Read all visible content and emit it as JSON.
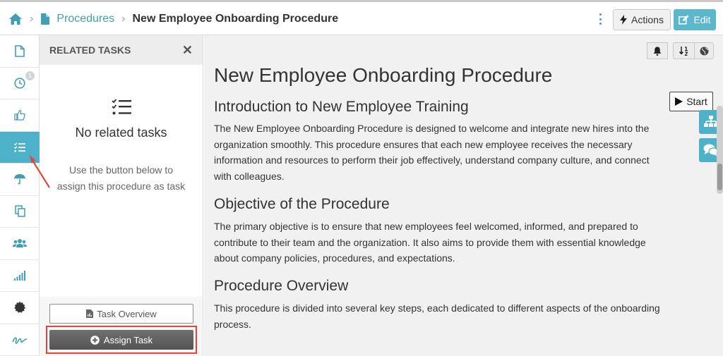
{
  "breadcrumb": {
    "home_icon": "home-icon",
    "parent_label": "Procedures",
    "parent_icon": "document-icon",
    "current_label": "New Employee Onboarding Procedure"
  },
  "toolbar": {
    "actions_label": "Actions",
    "edit_label": "Edit",
    "accent_color": "#5bb8cc"
  },
  "rail": {
    "items": [
      {
        "icon": "document-icon"
      },
      {
        "icon": "clock-icon",
        "badge": "1"
      },
      {
        "icon": "thumbs-up-icon"
      },
      {
        "icon": "tasks-icon",
        "active": true
      },
      {
        "icon": "umbrella-icon"
      },
      {
        "icon": "copy-icon"
      },
      {
        "icon": "users-icon"
      },
      {
        "icon": "signal-icon"
      },
      {
        "icon": "gear-icon"
      },
      {
        "icon": "signature-icon"
      }
    ]
  },
  "related_tasks": {
    "title": "RELATED TASKS",
    "empty_title": "No related tasks",
    "empty_text": "Use the button below to assign this procedure as task",
    "overview_label": "Task Overview",
    "assign_label": "Assign Task"
  },
  "document": {
    "title": "New Employee Onboarding Procedure",
    "start_label": "Start",
    "sections": [
      {
        "heading": "Introduction to New Employee Training",
        "body": "The New Employee Onboarding Procedure is designed to welcome and integrate new hires into the organization smoothly. This procedure ensures that each new employee receives the necessary information and resources to perform their job effectively, understand company culture, and connect with colleagues."
      },
      {
        "heading": "Objective of the Procedure",
        "body": "The primary objective is to ensure that new employees feel welcomed, informed, and prepared to contribute to their team and the organization. It also aims to provide them with essential knowledge about company policies, procedures, and expectations."
      },
      {
        "heading": "Procedure Overview",
        "body": "This procedure is divided into several key steps, each dedicated to different aspects of the onboarding process."
      }
    ]
  }
}
